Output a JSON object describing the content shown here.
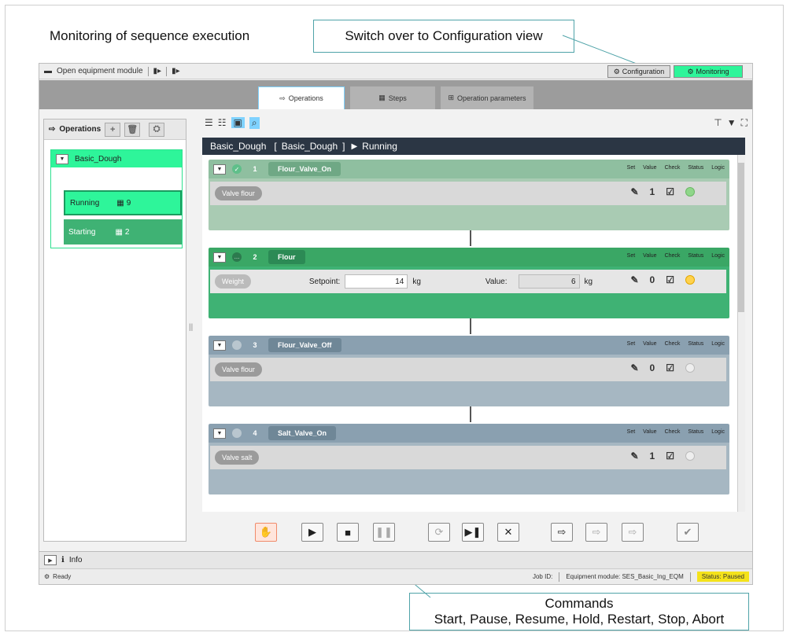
{
  "annotations": {
    "caption": "Monitoring of sequence execution",
    "switch_callout": "Switch over to Configuration view",
    "commands_title": "Commands",
    "commands_list": "Start, Pause, Resume, Hold, Restart, Stop, Abort"
  },
  "toolbar": {
    "open_module": "Open equipment module"
  },
  "views": {
    "configuration": "Configuration",
    "monitoring": "Monitoring"
  },
  "tabs": [
    {
      "label": "Operations"
    },
    {
      "label": "Steps"
    },
    {
      "label": "Operation parameters"
    }
  ],
  "left_panel": {
    "title": "Operations",
    "group": "Basic_Dough",
    "steps": [
      {
        "label": "Running",
        "count": "9"
      },
      {
        "label": "Starting",
        "count": "2"
      }
    ]
  },
  "sequence": {
    "name": "Basic_Dough",
    "bracket_name": "Basic_Dough",
    "state": "Running",
    "column_headers": [
      "Set",
      "Value",
      "Check",
      "Status",
      "Logic"
    ],
    "steps": [
      {
        "num": "1",
        "name": "Flour_Valve_On",
        "pill": "Valve flour",
        "value": "1"
      },
      {
        "num": "2",
        "name": "Flour",
        "pill": "Weight",
        "setpoint_label": "Setpoint:",
        "setpoint": "14",
        "unit": "kg",
        "value_label": "Value:",
        "actual": "6",
        "value": "0"
      },
      {
        "num": "3",
        "name": "Flour_Valve_Off",
        "pill": "Valve flour",
        "value": "0"
      },
      {
        "num": "4",
        "name": "Salt_Valve_On",
        "pill": "Valve salt",
        "value": "1"
      }
    ]
  },
  "info": {
    "label": "Info"
  },
  "status": {
    "ready": "Ready",
    "job_id": "Job ID:",
    "module": "Equipment module: SES_Basic_Ing_EQM",
    "state": "Status: Paused"
  },
  "colors": {
    "accent": "#2ef59a",
    "done": "#8fbfa0",
    "active": "#3aa765",
    "idle": "#8aa0b0",
    "status_paused": "#f4e21a"
  }
}
